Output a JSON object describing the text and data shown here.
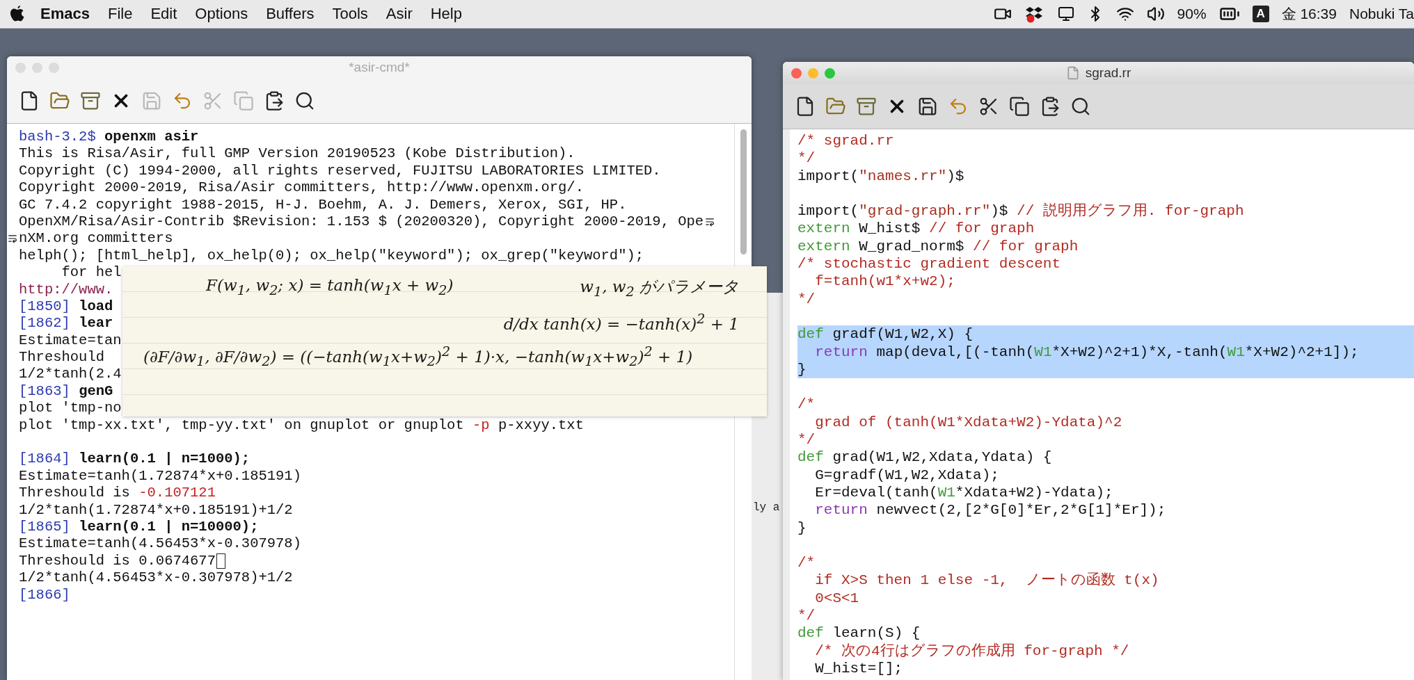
{
  "menu_bar": {
    "items": [
      {
        "label": "Emacs",
        "kind": "app"
      },
      {
        "label": "File",
        "kind": "menu"
      },
      {
        "label": "Edit",
        "kind": "menu"
      },
      {
        "label": "Options",
        "kind": "menu"
      },
      {
        "label": "Buffers",
        "kind": "menu"
      },
      {
        "label": "Tools",
        "kind": "menu"
      },
      {
        "label": "Asir",
        "kind": "menu"
      },
      {
        "label": "Help",
        "kind": "menu"
      }
    ],
    "status": {
      "battery": "90%",
      "input_source": "A",
      "clock": "金 16:39",
      "user": "Nobuki Ta"
    }
  },
  "windows": [
    {
      "kind": "terminal",
      "title": "*asir-cmd*",
      "active": false,
      "file_icon": false,
      "toolbar": [
        {
          "kind": "new",
          "disabled": false
        },
        {
          "kind": "open",
          "disabled": false
        },
        {
          "kind": "cabinet",
          "disabled": false
        },
        {
          "kind": "close",
          "disabled": false
        },
        {
          "kind": "save",
          "disabled": true
        },
        {
          "kind": "undo",
          "disabled": false
        },
        {
          "kind": "cut",
          "disabled": true
        },
        {
          "kind": "copy",
          "disabled": true
        },
        {
          "kind": "paste",
          "disabled": false
        },
        {
          "kind": "find",
          "disabled": false
        }
      ],
      "lines": [
        {
          "kind": "text",
          "segments": [
            {
              "kind": "prompt",
              "text": "bash-3.2$ "
            },
            {
              "kind": "bold",
              "text": "openxm asir"
            }
          ]
        },
        {
          "kind": "text",
          "segments": [
            {
              "kind": "plain",
              "text": "This is Risa/Asir, full GMP Version 20190523 (Kobe Distribution)."
            }
          ]
        },
        {
          "kind": "text",
          "segments": [
            {
              "kind": "plain",
              "text": "Copyright (C) 1994-2000, all rights reserved, FUJITSU LABORATORIES LIMITED."
            }
          ]
        },
        {
          "kind": "text",
          "segments": [
            {
              "kind": "plain",
              "text": "Copyright 2000-2019, Risa/Asir committers, http://www.openxm.org/."
            }
          ]
        },
        {
          "kind": "text",
          "segments": [
            {
              "kind": "plain",
              "text": "GC 7.4.2 copyright 1988-2015, H-J. Boehm, A. J. Demers, Xerox, SGI, HP."
            }
          ]
        },
        {
          "kind": "text",
          "wraps_to_next": true,
          "segments": [
            {
              "kind": "plain",
              "text": "OpenXM/Risa/Asir-Contrib $Revision: 1.153 $ (20200320), Copyright 2000-2019, Ope"
            }
          ]
        },
        {
          "kind": "text",
          "wrapped_from_previous": true,
          "segments": [
            {
              "kind": "plain",
              "text": "nXM.org committers"
            }
          ]
        },
        {
          "kind": "text",
          "segments": [
            {
              "kind": "plain",
              "text": "helph(); [html_help], ox_help(0); ox_help(\"keyword\"); ox_grep(\"keyword\");"
            }
          ]
        },
        {
          "kind": "text",
          "segments": [
            {
              "kind": "plain",
              "text": "     for hel"
            }
          ]
        },
        {
          "kind": "text",
          "segments": [
            {
              "kind": "link",
              "text": "http://www."
            }
          ]
        },
        {
          "kind": "text",
          "segments": [
            {
              "kind": "prompt",
              "text": "[1850] "
            },
            {
              "kind": "bold",
              "text": "load"
            }
          ]
        },
        {
          "kind": "text",
          "segments": [
            {
              "kind": "prompt",
              "text": "[1862] "
            },
            {
              "kind": "bold",
              "text": "lear"
            }
          ]
        },
        {
          "kind": "text",
          "segments": [
            {
              "kind": "plain",
              "text": "Estimate=tan"
            }
          ]
        },
        {
          "kind": "text",
          "segments": [
            {
              "kind": "plain",
              "text": "Threshould"
            }
          ]
        },
        {
          "kind": "text",
          "segments": [
            {
              "kind": "plain",
              "text": "1/2*tanh(2.4"
            }
          ]
        },
        {
          "kind": "text",
          "segments": [
            {
              "kind": "prompt",
              "text": "[1863] "
            },
            {
              "kind": "bold",
              "text": "genG"
            }
          ]
        },
        {
          "kind": "text",
          "segments": [
            {
              "kind": "plain",
              "text": "plot 'tmp-no"
            }
          ]
        },
        {
          "kind": "text",
          "segments": [
            {
              "kind": "plain",
              "text": "plot 'tmp-xx.txt', tmp-yy.txt' on gnuplot or gnuplot "
            },
            {
              "kind": "negative",
              "text": "-p"
            },
            {
              "kind": "plain",
              "text": " p-xxyy.txt"
            }
          ]
        },
        {
          "kind": "blank"
        },
        {
          "kind": "text",
          "segments": [
            {
              "kind": "prompt",
              "text": "[1864] "
            },
            {
              "kind": "bold",
              "text": "learn(0.1 | n=1000);"
            }
          ]
        },
        {
          "kind": "text",
          "segments": [
            {
              "kind": "plain",
              "text": "Estimate=tanh(1.72874*x+0.185191)"
            }
          ]
        },
        {
          "kind": "text",
          "segments": [
            {
              "kind": "plain",
              "text": "Threshould is "
            },
            {
              "kind": "negative",
              "text": "-0.107121"
            }
          ]
        },
        {
          "kind": "text",
          "segments": [
            {
              "kind": "plain",
              "text": "1/2*tanh(1.72874*x+0.185191)+1/2"
            }
          ]
        },
        {
          "kind": "text",
          "segments": [
            {
              "kind": "prompt",
              "text": "[1865] "
            },
            {
              "kind": "bold",
              "text": "learn(0.1 | n=10000);"
            }
          ]
        },
        {
          "kind": "text",
          "segments": [
            {
              "kind": "plain",
              "text": "Estimate=tanh(4.56453*x-0.307978)"
            }
          ]
        },
        {
          "kind": "text",
          "cursor": true,
          "segments": [
            {
              "kind": "plain",
              "text": "Threshould is 0.0674677"
            }
          ]
        },
        {
          "kind": "text",
          "segments": [
            {
              "kind": "plain",
              "text": "1/2*tanh(4.56453*x-0.307978)+1/2"
            }
          ]
        },
        {
          "kind": "text",
          "segments": [
            {
              "kind": "prompt",
              "text": "[1866]"
            }
          ]
        }
      ]
    },
    {
      "kind": "editor",
      "title": "sgrad.rr",
      "active": true,
      "file_icon": true,
      "toolbar": [
        {
          "kind": "new",
          "disabled": false
        },
        {
          "kind": "open",
          "disabled": false
        },
        {
          "kind": "cabinet",
          "disabled": false
        },
        {
          "kind": "close",
          "disabled": false
        },
        {
          "kind": "save",
          "disabled": false
        },
        {
          "kind": "undo",
          "disabled": false
        },
        {
          "kind": "cut",
          "disabled": false
        },
        {
          "kind": "copy",
          "disabled": false
        },
        {
          "kind": "paste",
          "disabled": false
        },
        {
          "kind": "find",
          "disabled": false
        }
      ],
      "lines": [
        {
          "kind": "text",
          "highlighted": false,
          "segments": [
            {
              "kind": "comment",
              "text": "/* sgrad.rr"
            }
          ]
        },
        {
          "kind": "text",
          "highlighted": false,
          "segments": [
            {
              "kind": "comment",
              "text": "*/"
            }
          ]
        },
        {
          "kind": "text",
          "highlighted": false,
          "segments": [
            {
              "kind": "plain",
              "text": "import("
            },
            {
              "kind": "string",
              "text": "\"names.rr\""
            },
            {
              "kind": "plain",
              "text": ")$"
            }
          ]
        },
        {
          "kind": "blank"
        },
        {
          "kind": "text",
          "highlighted": false,
          "segments": [
            {
              "kind": "plain",
              "text": "import("
            },
            {
              "kind": "string",
              "text": "\"grad-graph.rr\""
            },
            {
              "kind": "plain",
              "text": ")$ "
            },
            {
              "kind": "comment",
              "text": "// 説明用グラフ用. for-graph"
            }
          ]
        },
        {
          "kind": "text",
          "highlighted": false,
          "segments": [
            {
              "kind": "keyword",
              "text": "extern"
            },
            {
              "kind": "plain",
              "text": " W_hist$ "
            },
            {
              "kind": "comment",
              "text": "// for graph"
            }
          ]
        },
        {
          "kind": "text",
          "highlighted": false,
          "segments": [
            {
              "kind": "keyword",
              "text": "extern"
            },
            {
              "kind": "plain",
              "text": " W_grad_norm$ "
            },
            {
              "kind": "comment",
              "text": "// for graph"
            }
          ]
        },
        {
          "kind": "text",
          "highlighted": false,
          "segments": [
            {
              "kind": "comment",
              "text": "/* stochastic gradient descent"
            }
          ]
        },
        {
          "kind": "text",
          "highlighted": false,
          "segments": [
            {
              "kind": "comment",
              "text": "  f=tanh(w1*x+w2);"
            }
          ]
        },
        {
          "kind": "text",
          "highlighted": false,
          "segments": [
            {
              "kind": "comment",
              "text": "*/"
            }
          ]
        },
        {
          "kind": "blank"
        },
        {
          "kind": "text",
          "highlighted": true,
          "segments": [
            {
              "kind": "keyword",
              "text": "def"
            },
            {
              "kind": "plain",
              "text": " gradf(W1,W2,X) {"
            }
          ]
        },
        {
          "kind": "text",
          "highlighted": true,
          "segments": [
            {
              "kind": "return",
              "text": "  return"
            },
            {
              "kind": "plain",
              "text": " map(deval,[(-tanh("
            },
            {
              "kind": "var",
              "text": "W1"
            },
            {
              "kind": "plain",
              "text": "*X+W2)^2+1)*X,-tanh("
            },
            {
              "kind": "var",
              "text": "W1"
            },
            {
              "kind": "plain",
              "text": "*X+W2)^2+1]);"
            }
          ]
        },
        {
          "kind": "text",
          "highlighted": true,
          "segments": [
            {
              "kind": "plain",
              "text": "}"
            }
          ]
        },
        {
          "kind": "blank"
        },
        {
          "kind": "text",
          "highlighted": false,
          "segments": [
            {
              "kind": "comment",
              "text": "/*"
            }
          ]
        },
        {
          "kind": "text",
          "highlighted": false,
          "segments": [
            {
              "kind": "comment",
              "text": "  grad of (tanh(W1*Xdata+W2)-Ydata)^2"
            }
          ]
        },
        {
          "kind": "text",
          "highlighted": false,
          "segments": [
            {
              "kind": "comment",
              "text": "*/"
            }
          ]
        },
        {
          "kind": "text",
          "highlighted": false,
          "segments": [
            {
              "kind": "keyword",
              "text": "def"
            },
            {
              "kind": "plain",
              "text": " grad(W1,W2,Xdata,Ydata) {"
            }
          ]
        },
        {
          "kind": "text",
          "highlighted": false,
          "segments": [
            {
              "kind": "plain",
              "text": "  G=gradf(W1,W2,Xdata);"
            }
          ]
        },
        {
          "kind": "text",
          "highlighted": false,
          "segments": [
            {
              "kind": "plain",
              "text": "  Er=deval(tanh("
            },
            {
              "kind": "var",
              "text": "W1"
            },
            {
              "kind": "plain",
              "text": "*Xdata+W2)-Ydata);"
            }
          ]
        },
        {
          "kind": "text",
          "highlighted": false,
          "segments": [
            {
              "kind": "return",
              "text": "  return"
            },
            {
              "kind": "plain",
              "text": " newvect(2,[2*G[0]*Er,2*G[1]*Er]);"
            }
          ]
        },
        {
          "kind": "text",
          "highlighted": false,
          "segments": [
            {
              "kind": "plain",
              "text": "}"
            }
          ]
        },
        {
          "kind": "blank"
        },
        {
          "kind": "text",
          "highlighted": false,
          "segments": [
            {
              "kind": "comment",
              "text": "/*"
            }
          ]
        },
        {
          "kind": "text",
          "highlighted": false,
          "segments": [
            {
              "kind": "comment",
              "text": "  if X>S then 1 else -1,  ノートの函数 t(x)"
            }
          ]
        },
        {
          "kind": "text",
          "highlighted": false,
          "segments": [
            {
              "kind": "comment",
              "text": "  0<S<1"
            }
          ]
        },
        {
          "kind": "text",
          "highlighted": false,
          "segments": [
            {
              "kind": "comment",
              "text": "*/"
            }
          ]
        },
        {
          "kind": "text",
          "highlighted": false,
          "segments": [
            {
              "kind": "keyword",
              "text": "def"
            },
            {
              "kind": "plain",
              "text": " learn(S) {"
            }
          ]
        },
        {
          "kind": "text",
          "highlighted": false,
          "segments": [
            {
              "kind": "comment",
              "text": "  /* 次の4行はグラフの作成用 for-graph */"
            }
          ]
        },
        {
          "kind": "text",
          "highlighted": false,
          "segments": [
            {
              "kind": "plain",
              "text": "  W_hist=[];"
            }
          ]
        }
      ]
    }
  ],
  "background_window": {
    "text": "ly a"
  },
  "note": {
    "rows": [
      {
        "right_aligned": false,
        "texts": [
          "F(w$_{1}$, w$_{2}$; x) = tanh(w$_{1}$x + w$_{2}$)",
          "w$_{1}$, w$_{2}$ がパラメータ"
        ]
      },
      {
        "right_aligned": true,
        "texts": [
          "d/dx tanh(x) = −tanh(x)$^{2}$ + 1"
        ]
      },
      {
        "right_aligned": false,
        "texts": [
          "(∂F/∂w$_{1}$, ∂F/∂w$_{2}$) = ((−tanh(w$_{1}$x+w$_{2}$)$^{2}$ + 1)·x, −tanh(w$_{1}$x+w$_{2}$)$^{2}$ + 1)"
        ]
      }
    ]
  }
}
